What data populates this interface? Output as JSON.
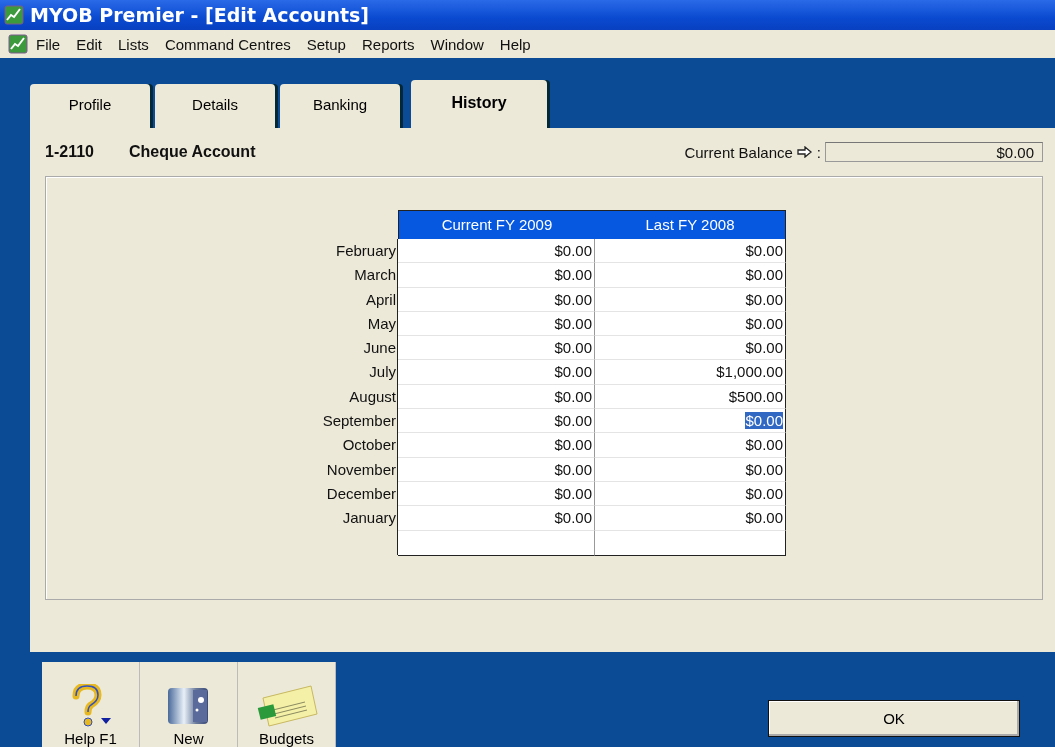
{
  "window": {
    "title": "MYOB Premier - [Edit Accounts]"
  },
  "menu": [
    "File",
    "Edit",
    "Lists",
    "Command Centres",
    "Setup",
    "Reports",
    "Window",
    "Help"
  ],
  "tabs": [
    {
      "label": "Profile",
      "selected": false
    },
    {
      "label": "Details",
      "selected": false
    },
    {
      "label": "Banking",
      "selected": false
    },
    {
      "label": "History",
      "selected": true
    }
  ],
  "account": {
    "number": "1-2110",
    "name": "Cheque Account",
    "balance_label": "Current Balance",
    "balance_colon": ":",
    "balance": "$0.00"
  },
  "table": {
    "columns": [
      "Current FY 2009",
      "Last FY 2008"
    ],
    "rows": [
      {
        "month": "February",
        "cells": [
          {
            "text": "$0.00",
            "selected": false
          },
          {
            "text": "$0.00",
            "selected": false
          }
        ]
      },
      {
        "month": "March",
        "cells": [
          {
            "text": "$0.00",
            "selected": false
          },
          {
            "text": "$0.00",
            "selected": false
          }
        ]
      },
      {
        "month": "April",
        "cells": [
          {
            "text": "$0.00",
            "selected": false
          },
          {
            "text": "$0.00",
            "selected": false
          }
        ]
      },
      {
        "month": "May",
        "cells": [
          {
            "text": "$0.00",
            "selected": false
          },
          {
            "text": "$0.00",
            "selected": false
          }
        ]
      },
      {
        "month": "June",
        "cells": [
          {
            "text": "$0.00",
            "selected": false
          },
          {
            "text": "$0.00",
            "selected": false
          }
        ]
      },
      {
        "month": "July",
        "cells": [
          {
            "text": "$0.00",
            "selected": false
          },
          {
            "text": "$1,000.00",
            "selected": false
          }
        ]
      },
      {
        "month": "August",
        "cells": [
          {
            "text": "$0.00",
            "selected": false
          },
          {
            "text": "$500.00",
            "selected": false
          }
        ]
      },
      {
        "month": "September",
        "cells": [
          {
            "text": "$0.00",
            "selected": false
          },
          {
            "text": "$0.00",
            "selected": true
          }
        ]
      },
      {
        "month": "October",
        "cells": [
          {
            "text": "$0.00",
            "selected": false
          },
          {
            "text": "$0.00",
            "selected": false
          }
        ]
      },
      {
        "month": "November",
        "cells": [
          {
            "text": "$0.00",
            "selected": false
          },
          {
            "text": "$0.00",
            "selected": false
          }
        ]
      },
      {
        "month": "December",
        "cells": [
          {
            "text": "$0.00",
            "selected": false
          },
          {
            "text": "$0.00",
            "selected": false
          }
        ]
      },
      {
        "month": "January",
        "cells": [
          {
            "text": "$0.00",
            "selected": false
          },
          {
            "text": "$0.00",
            "selected": false
          }
        ]
      }
    ]
  },
  "toolbar": [
    {
      "kind": "help",
      "label": "Help F1"
    },
    {
      "kind": "new",
      "label": "New"
    },
    {
      "kind": "budgets",
      "label": "Budgets"
    }
  ],
  "ok_button": "OK"
}
